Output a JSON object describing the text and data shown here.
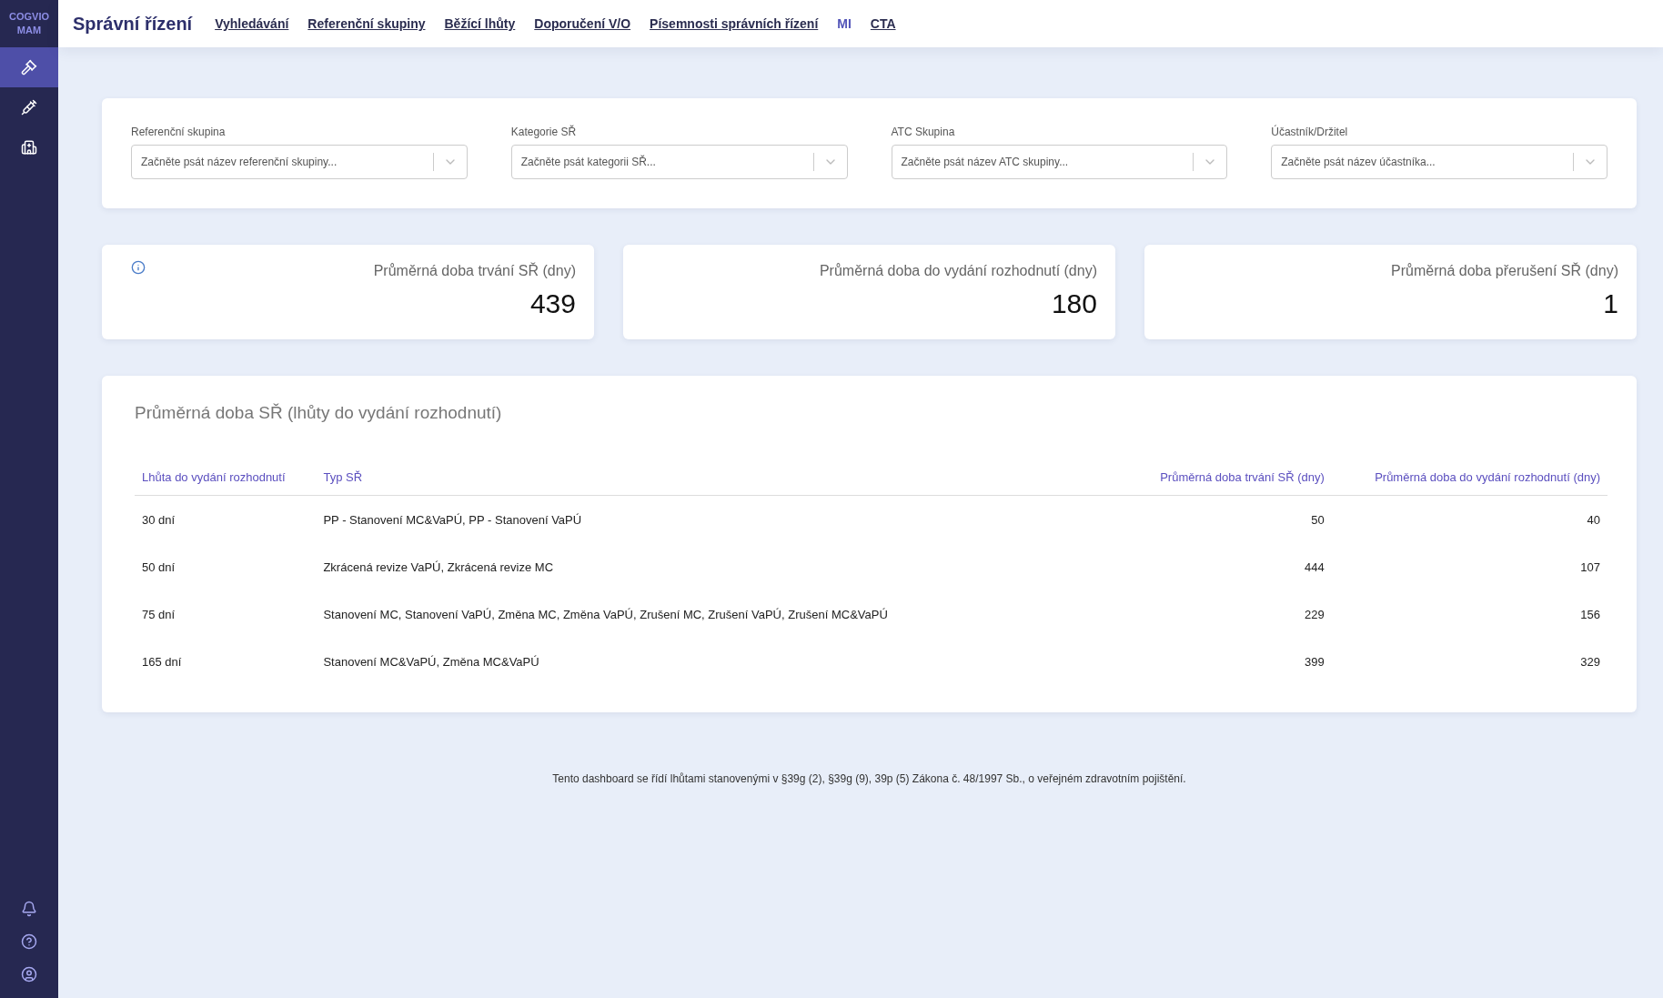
{
  "logo": {
    "line_1": "COGVIO",
    "line_2": "MAM"
  },
  "sidebar": {
    "items": [
      {
        "selected": true
      },
      {
        "selected": false
      },
      {
        "selected": false
      }
    ]
  },
  "header": {
    "title": "Správní řízení",
    "nav": [
      {
        "label": "Vyhledávání",
        "selected": false
      },
      {
        "label": "Referenční skupiny",
        "selected": false
      },
      {
        "label": "Běžící lhůty",
        "selected": false
      },
      {
        "label": "Doporučení V/O",
        "selected": false
      },
      {
        "label": "Písemnosti správních řízení",
        "selected": false
      },
      {
        "label": "MI",
        "selected": true
      },
      {
        "label": "CTA",
        "selected": false
      }
    ]
  },
  "filters": [
    {
      "label": "Referenční skupina",
      "placeholder": "Začněte psát název referenční skupiny..."
    },
    {
      "label": "Kategorie SŘ",
      "placeholder": "Začněte psát kategorii SŘ..."
    },
    {
      "label": "ATC Skupina",
      "placeholder": "Začněte psát název ATC skupiny..."
    },
    {
      "label": "Účastník/Držitel",
      "placeholder": "Začněte psát název účastníka..."
    }
  ],
  "kpis": [
    {
      "label": "Průměrná doba trvání SŘ (dny)",
      "value": "439",
      "info": true
    },
    {
      "label": "Průměrná doba do vydání rozhodnutí (dny)",
      "value": "180",
      "info": false
    },
    {
      "label": "Průměrná doba přerušení SŘ (dny)",
      "value": "1",
      "info": false
    }
  ],
  "table": {
    "title": "Průměrná doba SŘ (lhůty do vydání rozhodnutí)",
    "columns": [
      "Lhůta do vydání rozhodnutí",
      "Typ SŘ",
      "Průměrná doba trvání SŘ (dny)",
      "Průměrná doba do vydání rozhodnutí (dny)"
    ],
    "rows": [
      [
        "30 dní",
        "PP - Stanovení MC&VaPÚ, PP - Stanovení VaPÚ",
        "50",
        "40"
      ],
      [
        "50 dní",
        "Zkrácená revize VaPÚ, Zkrácená revize MC",
        "444",
        "107"
      ],
      [
        "75 dní",
        "Stanovení MC, Stanovení VaPÚ, Změna MC, Změna VaPÚ, Zrušení MC, Zrušení VaPÚ, Zrušení MC&VaPÚ",
        "229",
        "156"
      ],
      [
        "165 dní",
        "Stanovení MC&VaPÚ, Změna MC&VaPÚ",
        "399",
        "329"
      ]
    ]
  },
  "footer": "Tento dashboard se řídí lhůtami stanovenými v §39g (2), §39g (9), 39p (5) Zákona č. 48/1997 Sb., o veřejném zdravotním pojištění."
}
